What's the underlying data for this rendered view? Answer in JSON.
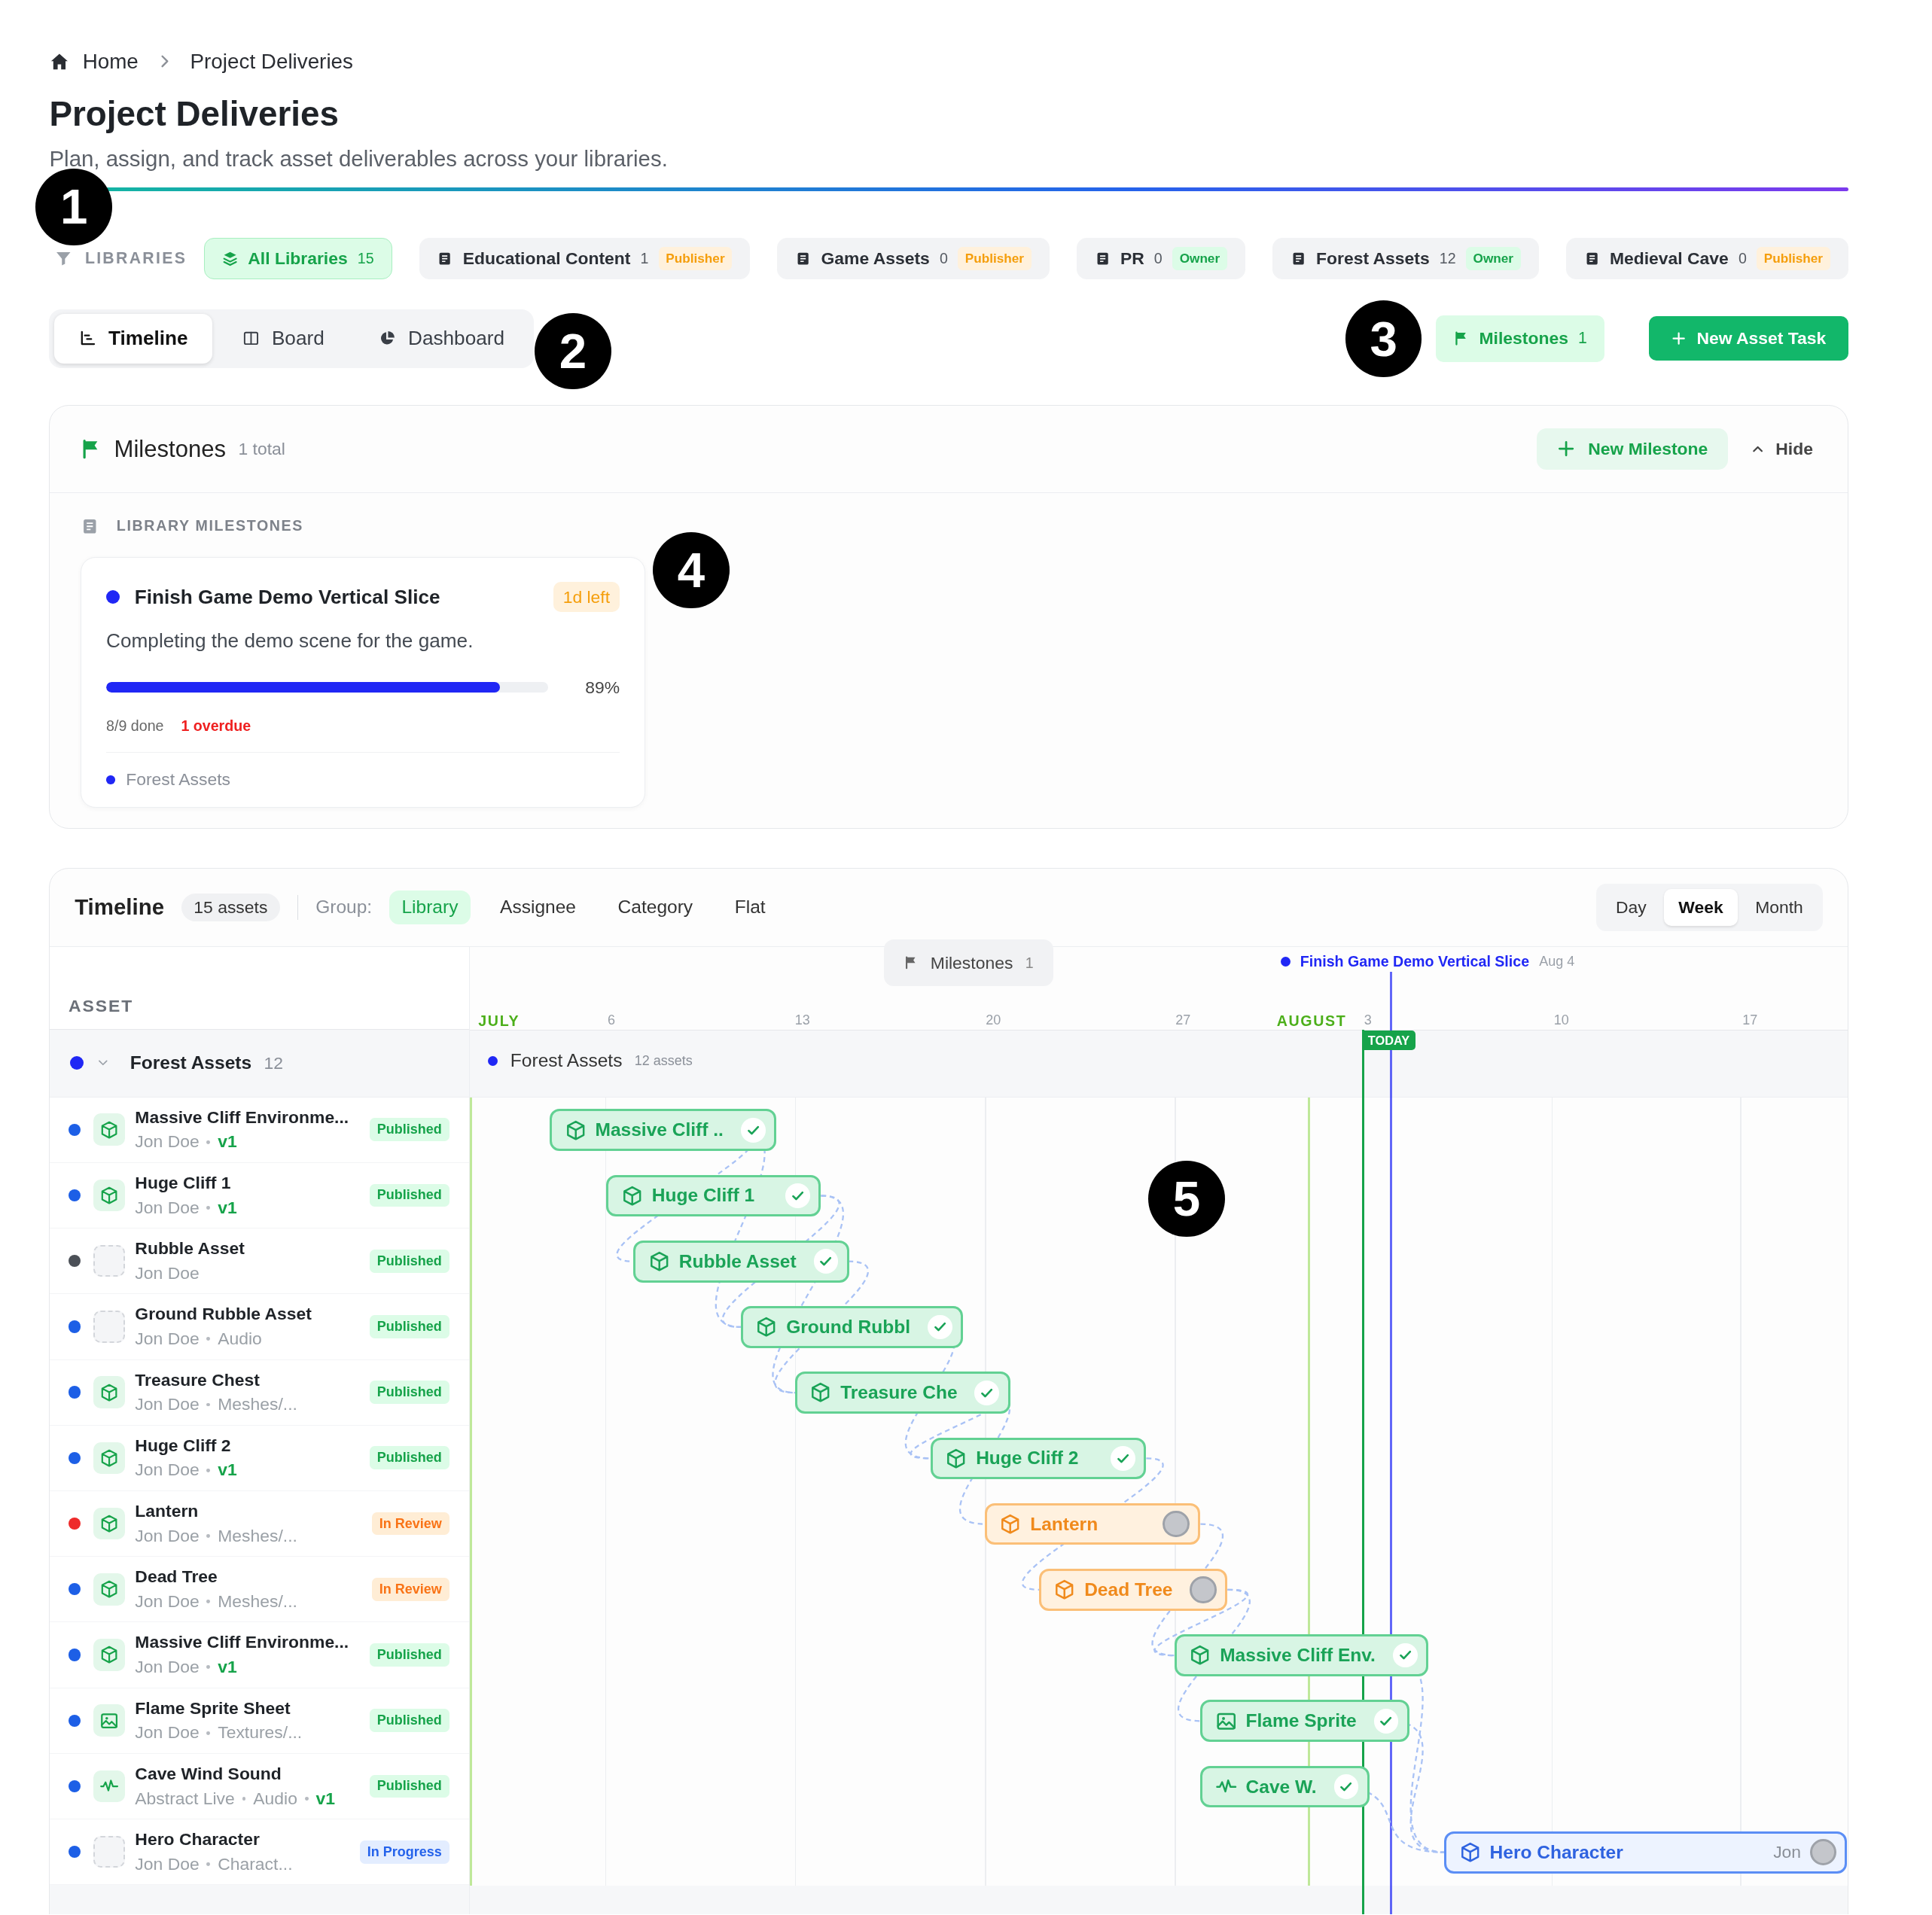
{
  "breadcrumb": [
    {
      "label": "Home",
      "kind": "home"
    },
    {
      "label": "Project Deliveries",
      "kind": "current"
    }
  ],
  "page": {
    "title": "Project Deliveries",
    "subtitle": "Plan, assign, and track asset deliverables across your libraries."
  },
  "libraries": {
    "label": "LIBRARIES",
    "items": [
      {
        "name": "All Libraries",
        "count": "15",
        "kind": "all",
        "selected": true
      },
      {
        "name": "Educational Content",
        "count": "1",
        "kind": "library",
        "role": {
          "label": "Publisher",
          "kind": "publisher"
        },
        "selected": false
      },
      {
        "name": "Game Assets",
        "count": "0",
        "kind": "library",
        "role": {
          "label": "Publisher",
          "kind": "publisher"
        },
        "selected": false
      },
      {
        "name": "PR",
        "count": "0",
        "kind": "library",
        "role": {
          "label": "Owner",
          "kind": "owner"
        },
        "selected": false
      },
      {
        "name": "Forest Assets",
        "count": "12",
        "kind": "library",
        "role": {
          "label": "Owner",
          "kind": "owner"
        },
        "selected": false
      },
      {
        "name": "Medieval Cave",
        "count": "0",
        "kind": "library",
        "role": {
          "label": "Publisher",
          "kind": "publisher"
        },
        "selected": false
      }
    ]
  },
  "views": [
    {
      "label": "Timeline",
      "kind": "timeline",
      "selected": true
    },
    {
      "label": "Board",
      "kind": "board",
      "selected": false
    },
    {
      "label": "Dashboard",
      "kind": "dashboard",
      "selected": false
    }
  ],
  "actions": {
    "milestones": {
      "label": "Milestones",
      "count": "1"
    },
    "new_task": {
      "label": "New Asset Task"
    }
  },
  "milestones_panel": {
    "title": "Milestones",
    "count": "1 total",
    "new_button": "New Milestone",
    "hide_button": "Hide",
    "section_label": "LIBRARY MILESTONES",
    "cards": [
      {
        "title": "Finish Game Demo Vertical Slice",
        "color": "#2027f5",
        "due": "1d left",
        "description": "Completing the demo scene for the game.",
        "level": 0.89,
        "percent": "89%",
        "done": "8/9 done",
        "overdue": "1 overdue",
        "library": {
          "name": "Forest Assets",
          "color": "#2027f5"
        }
      }
    ]
  },
  "timeline": {
    "title": "Timeline",
    "count": "15 assets",
    "group_label": "Group:",
    "group_options": [
      {
        "label": "Library",
        "selected": true
      },
      {
        "label": "Assignee",
        "selected": false
      },
      {
        "label": "Category",
        "selected": false
      },
      {
        "label": "Flat",
        "selected": false
      }
    ],
    "scales": [
      {
        "label": "Day",
        "selected": false
      },
      {
        "label": "Week",
        "selected": true
      },
      {
        "label": "Month",
        "selected": false
      }
    ],
    "column_header": "ASSET",
    "milestones_chip": {
      "label": "Milestones",
      "count": "1"
    },
    "milestone_marker": {
      "label": "Finish Game Demo Vertical Slice",
      "date": "Aug 4",
      "color": "#2027f5"
    },
    "axis": [
      {
        "label": "JULY",
        "kind": "month"
      },
      {
        "label": "6",
        "kind": "day"
      },
      {
        "label": "13",
        "kind": "day"
      },
      {
        "label": "20",
        "kind": "day"
      },
      {
        "label": "27",
        "kind": "day"
      },
      {
        "label": "AUGUST",
        "kind": "month"
      },
      {
        "label": "3",
        "kind": "day"
      },
      {
        "label": "10",
        "kind": "day"
      },
      {
        "label": "17",
        "kind": "day"
      }
    ],
    "today_label": "TODAY",
    "group": {
      "name": "Forest Assets",
      "count": "12",
      "color": "#2027f5",
      "expanded": true
    },
    "group_band": {
      "name": "Forest Assets",
      "count": "12 assets",
      "color": "#2027f5"
    },
    "rows": [
      {
        "name": "Massive Cliff Environme...",
        "color": "#1d5fe6",
        "kind": "model",
        "meta": [
          {
            "text": "Jon Doe",
            "kind": "text"
          },
          {
            "text": "v1",
            "kind": "version"
          }
        ],
        "status": {
          "label": "Published",
          "kind": "published"
        },
        "bar": {
          "label": "Massive Cliff ..",
          "kind": "done"
        }
      },
      {
        "name": "Huge Cliff 1",
        "color": "#1d5fe6",
        "kind": "model",
        "meta": [
          {
            "text": "Jon Doe",
            "kind": "text"
          },
          {
            "text": "v1",
            "kind": "version"
          }
        ],
        "status": {
          "label": "Published",
          "kind": "published"
        },
        "bar": {
          "label": "Huge Cliff 1",
          "kind": "done"
        }
      },
      {
        "name": "Rubble Asset",
        "color": "#4b5057",
        "kind": "empty",
        "meta": [
          {
            "text": "Jon Doe",
            "kind": "text"
          }
        ],
        "status": {
          "label": "Published",
          "kind": "published"
        },
        "bar": {
          "label": "Rubble Asset",
          "kind": "done"
        }
      },
      {
        "name": "Ground Rubble Asset",
        "color": "#1d5fe6",
        "kind": "empty",
        "meta": [
          {
            "text": "Jon Doe",
            "kind": "text"
          },
          {
            "text": "Audio",
            "kind": "text"
          }
        ],
        "status": {
          "label": "Published",
          "kind": "published"
        },
        "bar": {
          "label": "Ground Rubbl",
          "kind": "done"
        }
      },
      {
        "name": "Treasure Chest",
        "color": "#1d5fe6",
        "kind": "model",
        "meta": [
          {
            "text": "Jon Doe",
            "kind": "text"
          },
          {
            "text": "Meshes/...",
            "kind": "text"
          }
        ],
        "status": {
          "label": "Published",
          "kind": "published"
        },
        "bar": {
          "label": "Treasure Che",
          "kind": "done"
        }
      },
      {
        "name": "Huge Cliff 2",
        "color": "#1d5fe6",
        "kind": "model",
        "meta": [
          {
            "text": "Jon Doe",
            "kind": "text"
          },
          {
            "text": "v1",
            "kind": "version"
          }
        ],
        "status": {
          "label": "Published",
          "kind": "published"
        },
        "bar": {
          "label": "Huge Cliff 2",
          "kind": "done"
        }
      },
      {
        "name": "Lantern",
        "color": "#ee2a2a",
        "kind": "model",
        "meta": [
          {
            "text": "Jon Doe",
            "kind": "text"
          },
          {
            "text": "Meshes/...",
            "kind": "text"
          }
        ],
        "status": {
          "label": "In Review",
          "kind": "review"
        },
        "bar": {
          "label": "Lantern",
          "kind": "review"
        }
      },
      {
        "name": "Dead Tree",
        "color": "#1d5fe6",
        "kind": "model",
        "meta": [
          {
            "text": "Jon Doe",
            "kind": "text"
          },
          {
            "text": "Meshes/...",
            "kind": "text"
          }
        ],
        "status": {
          "label": "In Review",
          "kind": "review"
        },
        "bar": {
          "label": "Dead Tree",
          "kind": "review"
        }
      },
      {
        "name": "Massive Cliff Environme...",
        "color": "#1d5fe6",
        "kind": "model",
        "meta": [
          {
            "text": "Jon Doe",
            "kind": "text"
          },
          {
            "text": "v1",
            "kind": "version"
          }
        ],
        "status": {
          "label": "Published",
          "kind": "published"
        },
        "bar": {
          "label": "Massive Cliff Env.",
          "kind": "done"
        }
      },
      {
        "name": "Flame Sprite Sheet",
        "color": "#1d5fe6",
        "kind": "image",
        "meta": [
          {
            "text": "Jon Doe",
            "kind": "text"
          },
          {
            "text": "Textures/...",
            "kind": "text"
          }
        ],
        "status": {
          "label": "Published",
          "kind": "published"
        },
        "bar": {
          "label": "Flame Sprite",
          "kind": "done"
        }
      },
      {
        "name": "Cave Wind Sound",
        "color": "#1d5fe6",
        "kind": "audio",
        "meta": [
          {
            "text": "Abstract Live",
            "kind": "text"
          },
          {
            "text": "Audio",
            "kind": "text"
          },
          {
            "text": "v1",
            "kind": "version"
          }
        ],
        "status": {
          "label": "Published",
          "kind": "published"
        },
        "bar": {
          "label": "Cave W.",
          "kind": "done"
        }
      },
      {
        "name": "Hero Character",
        "color": "#1d5fe6",
        "kind": "empty",
        "meta": [
          {
            "text": "Jon Doe",
            "kind": "text"
          },
          {
            "text": "Charact...",
            "kind": "text"
          }
        ],
        "status": {
          "label": "In Progress",
          "kind": "progress"
        },
        "bar": {
          "label": "Hero Character",
          "kind": "progress",
          "assignee": "Jon"
        }
      }
    ]
  },
  "annotations": [
    {
      "label": "1"
    },
    {
      "label": "2"
    },
    {
      "label": "3"
    },
    {
      "label": "4"
    },
    {
      "label": "5"
    }
  ]
}
